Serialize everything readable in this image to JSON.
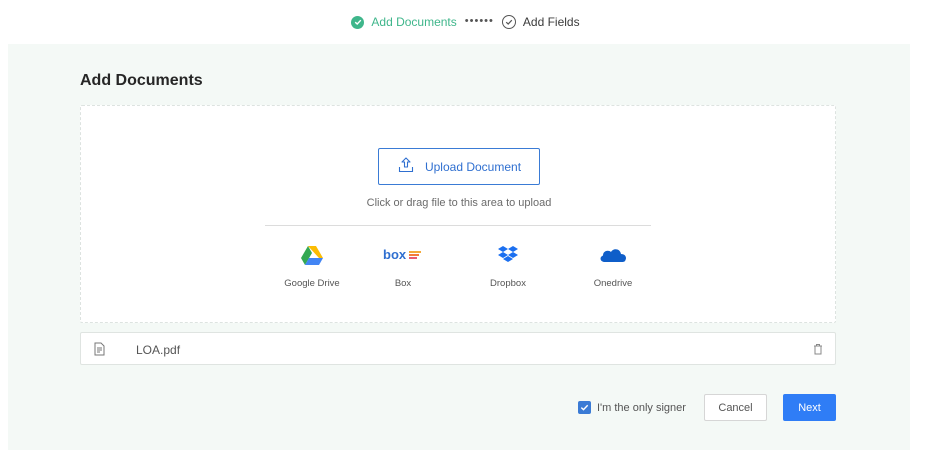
{
  "stepper": {
    "step1_label": "Add Documents",
    "step2_label": "Add Fields",
    "separator": "••••••",
    "active_color": "#3fb68b"
  },
  "page": {
    "title": "Add Documents"
  },
  "dropzone": {
    "upload_label": "Upload Document",
    "hint": "Click or drag file to this area to upload",
    "providers": [
      {
        "label": "Google Drive",
        "icon": "google-drive-icon"
      },
      {
        "label": "Box",
        "icon": "box-icon"
      },
      {
        "label": "Dropbox",
        "icon": "dropbox-icon"
      },
      {
        "label": "Onedrive",
        "icon": "onedrive-icon"
      }
    ]
  },
  "file": {
    "name": "LOA.pdf",
    "icon": "document-icon"
  },
  "footer": {
    "only_signer_label": "I'm the only signer",
    "only_signer_checked": true,
    "cancel_label": "Cancel",
    "next_label": "Next",
    "primary_color": "#2f7df6"
  }
}
